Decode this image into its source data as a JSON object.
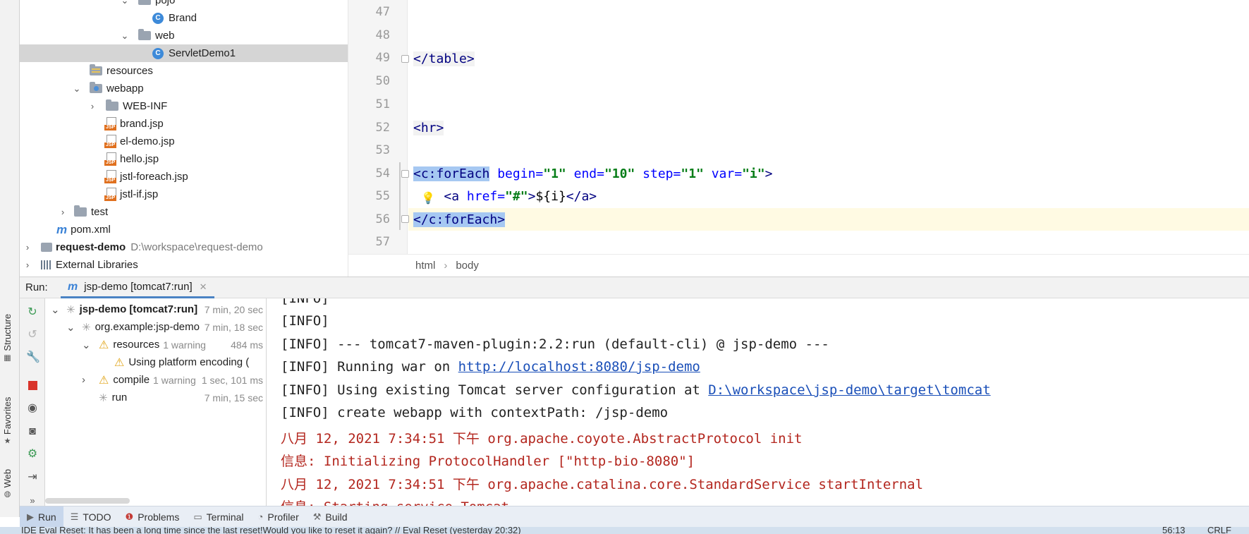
{
  "project_tree": {
    "items": [
      {
        "label": "pojo",
        "kind": "folder",
        "expanded": true
      },
      {
        "label": "Brand",
        "kind": "class"
      },
      {
        "label": "web",
        "kind": "folder",
        "expanded": true
      },
      {
        "label": "ServletDemo1",
        "kind": "class",
        "selected": true
      },
      {
        "label": "resources",
        "kind": "resources-folder"
      },
      {
        "label": "webapp",
        "kind": "web-folder",
        "expanded": true
      },
      {
        "label": "WEB-INF",
        "kind": "folder",
        "expanded": false
      },
      {
        "label": "brand.jsp",
        "kind": "jsp"
      },
      {
        "label": "el-demo.jsp",
        "kind": "jsp"
      },
      {
        "label": "hello.jsp",
        "kind": "jsp"
      },
      {
        "label": "jstl-foreach.jsp",
        "kind": "jsp"
      },
      {
        "label": "jstl-if.jsp",
        "kind": "jsp"
      },
      {
        "label": "test",
        "kind": "folder",
        "expanded": false
      },
      {
        "label": "pom.xml",
        "kind": "maven"
      },
      {
        "label": "request-demo",
        "kind": "project",
        "path": "D:\\workspace\\request-demo"
      },
      {
        "label": "External Libraries",
        "kind": "libraries"
      }
    ]
  },
  "editor": {
    "lines": [
      {
        "no": "47",
        "code": ""
      },
      {
        "no": "48",
        "code": ""
      },
      {
        "no": "49",
        "code": "</table>"
      },
      {
        "no": "50",
        "code": ""
      },
      {
        "no": "51",
        "code": ""
      },
      {
        "no": "52",
        "code": "<hr>"
      },
      {
        "no": "53",
        "code": ""
      },
      {
        "no": "54",
        "code": "<c:forEach begin=\"1\" end=\"10\" step=\"1\" var=\"i\">"
      },
      {
        "no": "55",
        "code": "    <a href=\"#\">${i}</a>"
      },
      {
        "no": "56",
        "code": "</c:forEach>"
      },
      {
        "no": "57",
        "code": ""
      }
    ],
    "line54": {
      "open": "<c:forEach",
      "begin_attr": "begin=",
      "begin_val": "\"1\"",
      "end_attr": "end=",
      "end_val": "\"10\"",
      "step_attr": "step=",
      "step_val": "\"1\"",
      "var_attr": "var=",
      "var_val": "\"i\"",
      "close": ">"
    },
    "line55": {
      "open": "<a",
      "href_attr": "href=",
      "href_val": "\"#\"",
      "close": ">",
      "expr": "${i}",
      "end_tag": "</a>"
    },
    "line49": "</table>",
    "line52": "<hr>",
    "line56": "</c:forEach>",
    "breadcrumb": [
      "html",
      "body"
    ]
  },
  "run_panel": {
    "label": "Run:",
    "tab_title": "jsp-demo [tomcat7:run]",
    "tree": [
      {
        "label": "jsp-demo [tomcat7:run]",
        "time": "7 min, 20 sec",
        "bold": true,
        "status": "running"
      },
      {
        "label": "org.example:jsp-demo",
        "time": "7 min, 18 sec",
        "status": "running"
      },
      {
        "label": "resources",
        "extra": "1 warning",
        "time": "484 ms",
        "status": "warning"
      },
      {
        "label": "Using platform encoding (",
        "status": "warning"
      },
      {
        "label": "compile",
        "extra": "1 warning",
        "time": "1 sec, 101 ms",
        "status": "warning"
      },
      {
        "label": "run",
        "time": "7 min, 15 sec",
        "status": "running"
      }
    ],
    "console": [
      {
        "text": "[INFO]",
        "color": "normal"
      },
      {
        "text": "[INFO]",
        "color": "normal"
      },
      {
        "text": "[INFO] --- tomcat7-maven-plugin:2.2:run (default-cli) @ jsp-demo ---",
        "color": "normal"
      },
      {
        "text": "[INFO] Running war on ",
        "link": "http://localhost:8080/jsp-demo",
        "color": "normal"
      },
      {
        "text": "[INFO] Using existing Tomcat server configuration at ",
        "link": "D:\\workspace\\jsp-demo\\target\\tomcat",
        "color": "normal"
      },
      {
        "text": "[INFO] create webapp with contextPath: /jsp-demo",
        "color": "normal"
      },
      {
        "text": "八月 12, 2021 7:34:51 下午 org.apache.coyote.AbstractProtocol init",
        "color": "red"
      },
      {
        "text": "信息: Initializing ProtocolHandler [\"http-bio-8080\"]",
        "color": "red"
      },
      {
        "text": "八月 12, 2021 7:34:51 下午 org.apache.catalina.core.StandardService startInternal",
        "color": "red"
      },
      {
        "text": "信息: Starting service Tomcat",
        "color": "red"
      }
    ]
  },
  "side_tabs": {
    "structure": "Structure",
    "favorites": "Favorites",
    "web": "Web"
  },
  "tool_tabs": [
    {
      "label": "Run",
      "icon": "play-icon",
      "active": true
    },
    {
      "label": "TODO",
      "icon": "list-icon"
    },
    {
      "label": "Problems",
      "icon": "problems-icon"
    },
    {
      "label": "Terminal",
      "icon": "terminal-icon"
    },
    {
      "label": "Profiler",
      "icon": "profiler-icon"
    },
    {
      "label": "Build",
      "icon": "hammer-icon"
    }
  ],
  "status_bar": {
    "message": "IDE Eval Reset: It has been a long time since the last reset!Would you like to reset it again? // Eval Reset (yesterday 20:32)",
    "position": "56:13",
    "line_sep": "CRLF"
  }
}
